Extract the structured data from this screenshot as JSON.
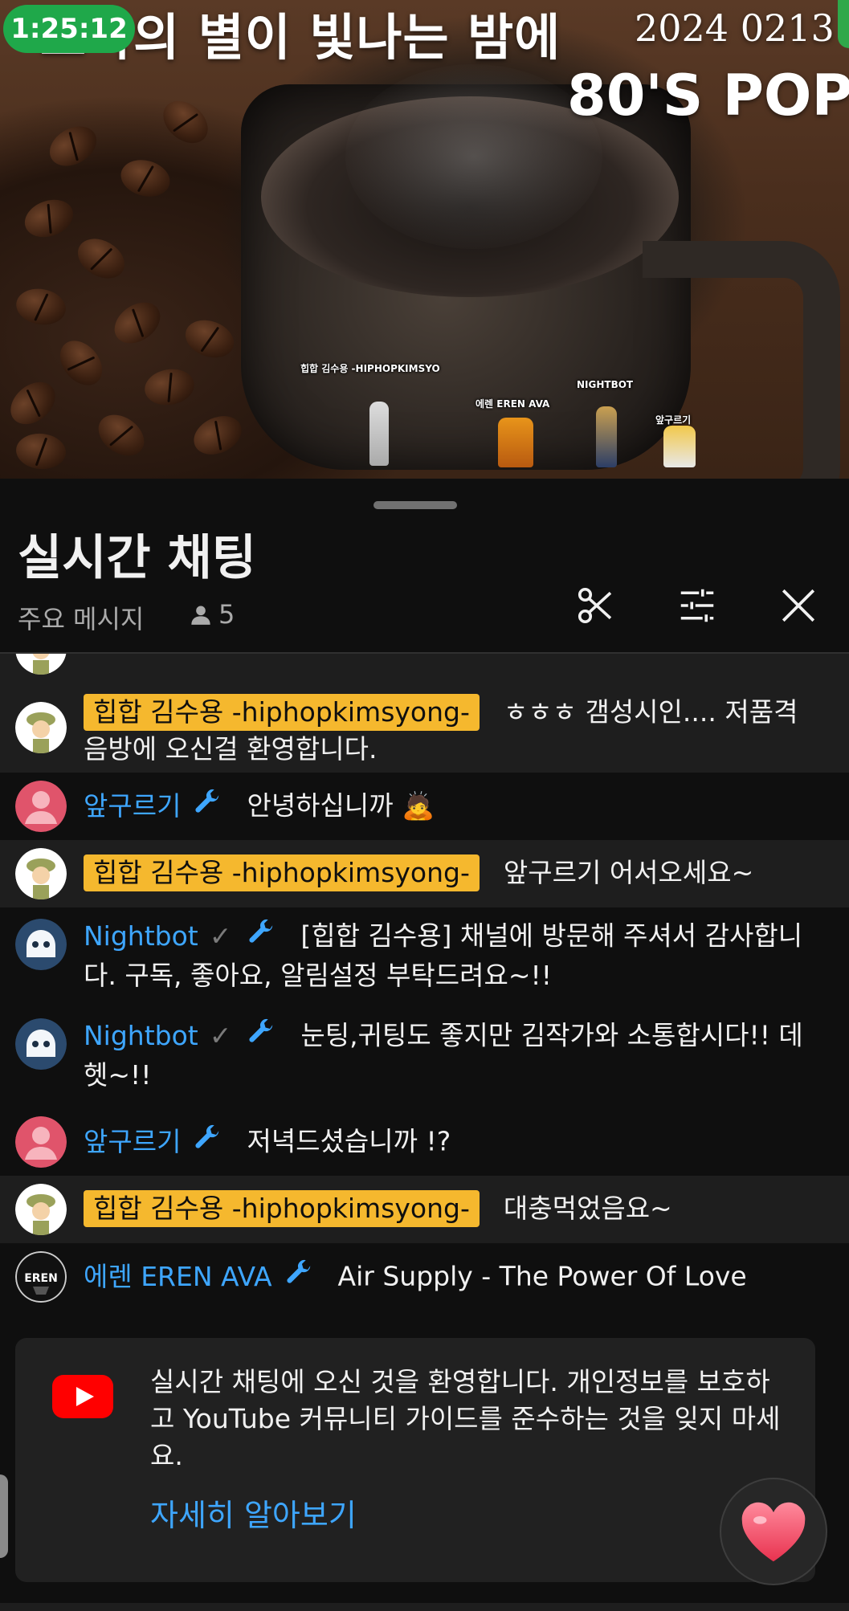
{
  "video": {
    "title": "조각의 별이 빛나는 밤에",
    "date": "2024 0213",
    "subtitle": "80'S POP",
    "timer": "1:25:12",
    "avatars": [
      "힙합 김수용 -HIPHOPKIMSYO",
      "에렌 EREN AVA",
      "NIGHTBOT",
      "앞구르기"
    ]
  },
  "chat": {
    "title": "실시간 채팅",
    "mode": "주요 메시지",
    "viewer_count": "5",
    "messages": [
      {
        "author": "힙합 김수용 -hiphopkimsyong-",
        "text": "ㅎㅎㅎ 갬성시인.... 저품격 음방에 오신걸 환영합니다."
      },
      {
        "author": "앞구르기",
        "text": "안녕하십니까 🙇"
      },
      {
        "author": "힙합 김수용 -hiphopkimsyong-",
        "text": "앞구르기 어서오세요~"
      },
      {
        "author": "Nightbot",
        "text": "[힙합 김수용] 채널에 방문해 주셔서 감사합니다. 구독, 좋아요, 알림설정 부탁드려요~!!"
      },
      {
        "author": "Nightbot",
        "text": "눈팅,귀팅도 좋지만 김작가와 소통합시다!! 데헷~!!"
      },
      {
        "author": "앞구르기",
        "text": "저녁드셨습니까 !?"
      },
      {
        "author": "힙합 김수용 -hiphopkimsyong-",
        "text": "대충먹었음요~"
      },
      {
        "author": "에렌 EREN AVA",
        "text": "Air Supply - The Power Of Love"
      }
    ]
  },
  "welcome": {
    "text": "실시간 채팅에 오신 것을 환영합니다. 개인정보를 보호하고 YouTube 커뮤니티 가이드를 준수하는 것을 잊지 마세요.",
    "learn_more": "자세히 알아보기"
  },
  "icons": {
    "clip": "scissors-icon",
    "filter": "sliders-icon",
    "close": "close-icon",
    "heart": "heart-icon",
    "moderator": "wrench-icon",
    "verified": "checkmark-icon",
    "viewers": "person-icon"
  },
  "colors": {
    "author_link": "#3ea6ff",
    "owner_chip": "#f5b82e",
    "live_badge": "#1fa84a",
    "youtube_red": "#ff0000"
  }
}
